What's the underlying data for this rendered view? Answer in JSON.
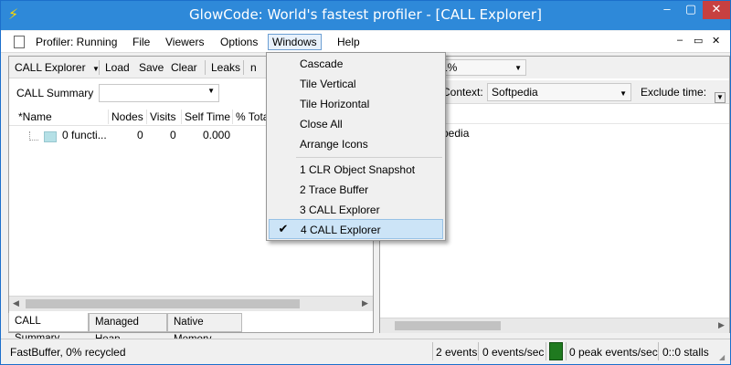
{
  "window": {
    "title": "GlowCode: World's fastest profiler - [CALL Explorer]",
    "controls": {
      "minimize": "–",
      "maximize": "▢",
      "close": "✕"
    }
  },
  "menu": {
    "items": [
      "Profiler: Running",
      "File",
      "Viewers",
      "Options",
      "Windows",
      "Help"
    ],
    "mdi_controls": [
      "–",
      "▭",
      "✕"
    ]
  },
  "left_toolbar": {
    "explorer_label": "CALL Explorer",
    "load": "Load",
    "save": "Save",
    "clear": "Clear",
    "leaks": "Leaks",
    "cut_text": "n"
  },
  "summary": {
    "label": "CALL Summary",
    "selected": ""
  },
  "table": {
    "headers": [
      "*Name",
      "Nodes",
      "Visits",
      "Self Time",
      "% Total"
    ],
    "rows": [
      {
        "name": "0 functi...",
        "nodes": "0",
        "visits": "0",
        "self_time": "0.000"
      }
    ]
  },
  "bottom_tabs": [
    "CALL Summary",
    "Managed Heap",
    "Native Memory"
  ],
  "right_panel": {
    "combo_value": "1%",
    "context_label": "Context:",
    "context_value": "Softpedia",
    "exclude_label": "Exclude time:",
    "content_text": "pedia"
  },
  "windows_menu": {
    "items": [
      "Cascade",
      "Tile Vertical",
      "Tile Horizontal",
      "Close All",
      "Arrange Icons"
    ],
    "windows": [
      "1 CLR Object Snapshot",
      "2 Trace Buffer",
      "3 CALL Explorer",
      "4 CALL Explorer"
    ],
    "checked_index": 3,
    "check_icon": "checkmark-icon"
  },
  "status": {
    "buffer": "FastBuffer, 0% recycled",
    "events": "2 events",
    "events_per_sec": "0 events/sec",
    "peak": "0 peak events/sec",
    "stalls": "0::0 stalls",
    "indicator_color": "#1f7a1f"
  }
}
